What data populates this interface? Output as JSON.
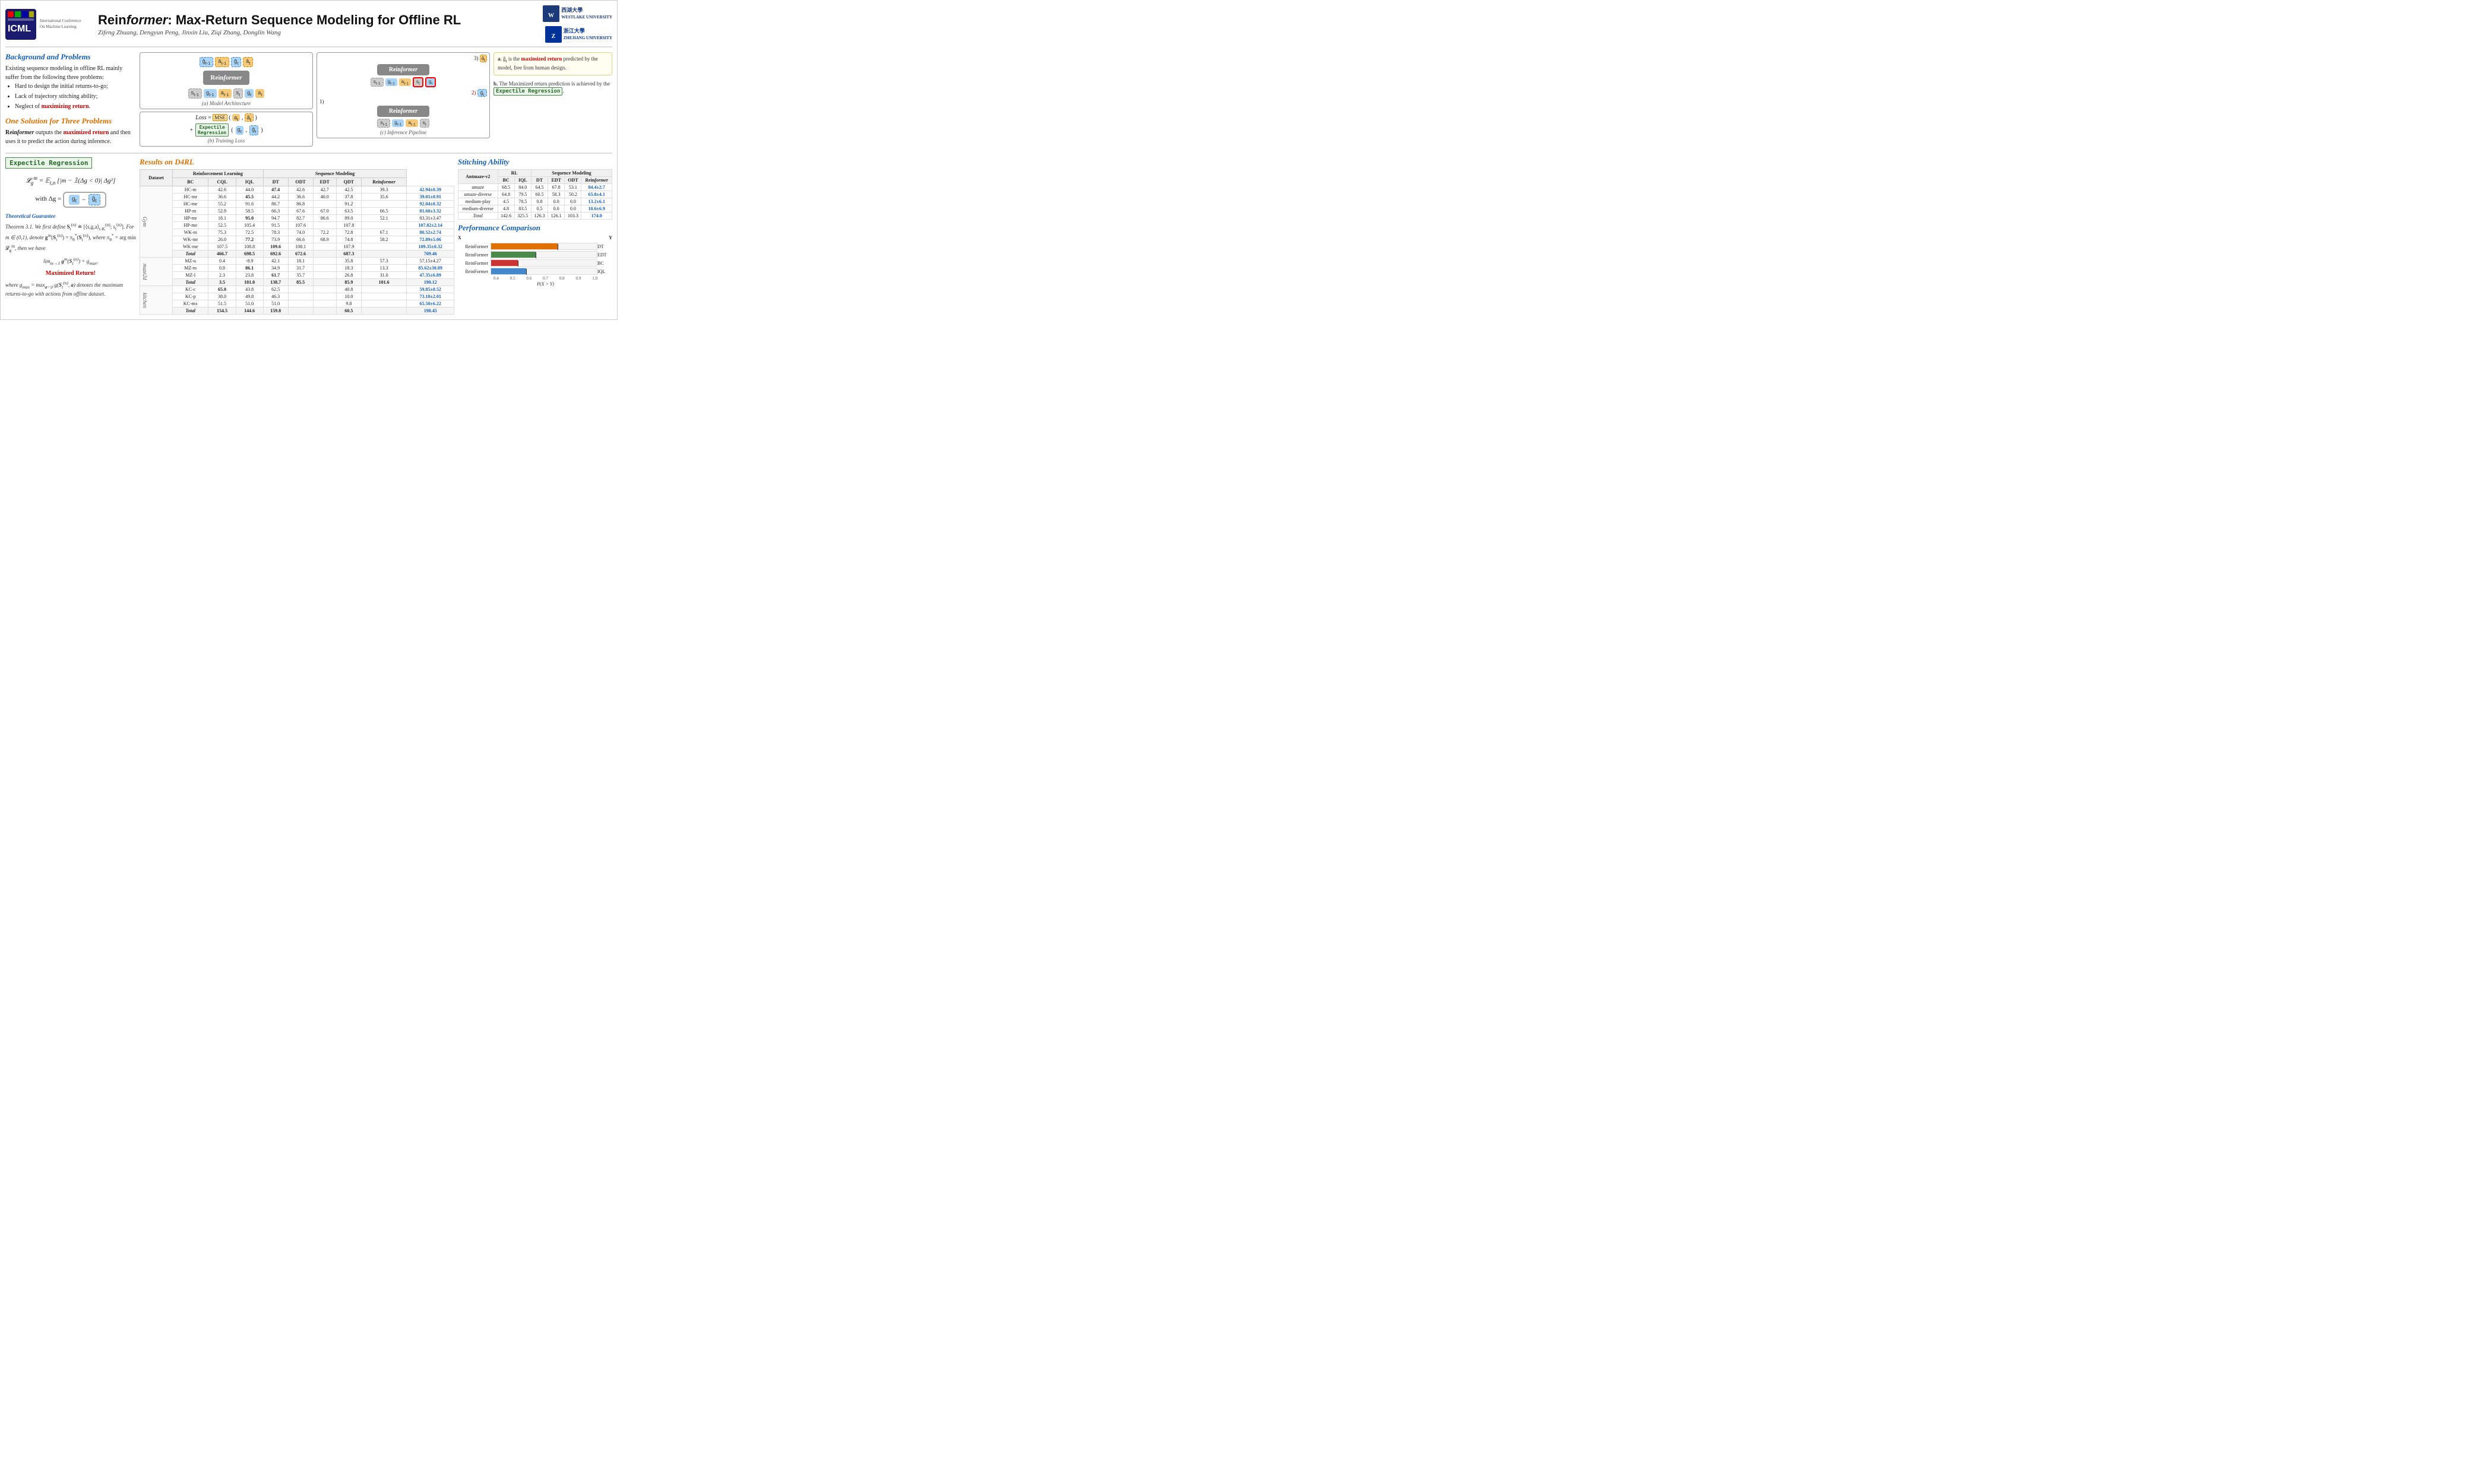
{
  "header": {
    "title_pre": "Rein",
    "title_italic": "former",
    "title_post": ": Max-Return Sequence Modeling for Offline RL",
    "authors": "Zifeng Zhuang, Dengyun Peng, Jinxin Liu, Ziqi Zhang, Donglin Wang",
    "icml_label": "ICML",
    "icml_subtext": "International Conference On Machine Learning",
    "univ1": "西湖大學\nWESTLAKE UNIVERSITY",
    "univ2": "浙江大學\nZHEJIANG UNIVERSITY"
  },
  "background": {
    "title": "Background and Problems",
    "body": "Existing sequence modeling in offline RL mainly suffer from the following three problems:",
    "bullets": [
      "Hard to design the initial returns-to-go;",
      "Lack of trajectory stitching ability;",
      "Neglect of maximizing return."
    ]
  },
  "one_solution": {
    "title": "One Solution for Three Problems",
    "body_pre": "Rein",
    "body_italic": "former",
    "body_post": " outputs the maximized return and then uses it to predict the action during inference."
  },
  "arch_diagram": {
    "title": "(a) Model Architecture",
    "tokens_top": [
      "ĝ_{t-1}",
      "â_{t-1}",
      "ĝ_t",
      "â_t"
    ],
    "reformer_label_pre": "Rein",
    "reformer_label_italic": "former",
    "tokens_bottom": [
      "s_{t-1}",
      "g_{t-1}",
      "a_{t-1}",
      "s_t",
      "g_t",
      "a_t"
    ],
    "loss_title": "(b) Training Loss",
    "loss_eq": "Loss = MSE( a_t , â_t )",
    "loss_plus": "+ Expectile Regression( g_t , ĝ_t )"
  },
  "inference_diagram": {
    "title": "(c) Inference Pipeline",
    "step1": "1)",
    "step2": "2)",
    "step3": "3)"
  },
  "annotations": {
    "a_text": "a. ĝ_t is the maximized return predicted by the model, free from human design.",
    "b_text": "b. The Maximized return prediction is achieved by the Expectile Regression."
  },
  "expectile": {
    "box_label": "Expectile Regression",
    "formula1": "𝓛_g^m = 𝔼_{t,n} [|m − 𝟙(Δg < 0)| Δg²]",
    "formula2": "with Δg = ( g_t − ĝ_t )",
    "theorem_title": "Theoretical Guarantee",
    "theorem_text": "Theorem 3.1. We first define S_t^(n) ≐ [⟨s, g, a⟩_{t-K}^(n); s_t^(n)]. For m ∈ (0,1), denote g^m(S_t^(n)) = π_θ^*(S_t^(n)), where π_θ^* = arg min 𝓛_g^m, then we have",
    "limit_formula": "lim_{m→1} g^m(S_t^(n)) = g_max,",
    "max_return_label": "Maximized Return!",
    "gmax_def": "where g_max = max_{a~𝒟} g(S_t^(n), a) denotes the maximum returns-to-go with actions from offline dataset."
  },
  "results_d4rl": {
    "title": "Results on D4RL",
    "col_groups": [
      {
        "name": "Reinforcement Learning",
        "cols": [
          "BC",
          "CQL",
          "IQL"
        ]
      },
      {
        "name": "Sequence Modeling",
        "cols": [
          "DT",
          "ODT",
          "EDT",
          "QDT",
          "Reformer"
        ]
      }
    ],
    "row_groups": [
      {
        "name": "Gym",
        "rows": [
          {
            "dataset": "HC-m",
            "bc": "42.6",
            "cql": "44.0",
            "iql": "47.4",
            "dt": "42.6",
            "odt": "42.7",
            "edt": "42.5",
            "qdt": "39.3",
            "ref": "42.94±0.39",
            "ref_color": "blue"
          },
          {
            "dataset": "HC-mr",
            "bc": "36.6",
            "cql": "45.5",
            "iql": "44.2",
            "dt": "36.6",
            "odt": "40.0",
            "edt": "37.8",
            "qdt": "35.6",
            "ref": "39.01±0.91",
            "ref_color": "blue"
          },
          {
            "dataset": "HC-me",
            "bc": "55.2",
            "cql": "91.6",
            "iql": "86.7",
            "dt": "86.8",
            "odt": "",
            "edt": "91.2",
            "qdt": "",
            "ref": "92.04±0.32",
            "ref_color": "blue"
          },
          {
            "dataset": "HP-m",
            "bc": "52.9",
            "cql": "58.5",
            "iql": "66.3",
            "dt": "67.6",
            "odt": "67.0",
            "edt": "63.5",
            "qdt": "66.5",
            "ref": "81.60±3.32",
            "ref_color": "blue"
          },
          {
            "dataset": "HP-mr",
            "bc": "18.1",
            "cql": "95.0",
            "iql": "94.7",
            "dt": "82.7",
            "odt": "86.6",
            "edt": "89.0",
            "qdt": "52.1",
            "ref": "83.31±3.47",
            "ref_color": "normal"
          },
          {
            "dataset": "HP-me",
            "bc": "52.5",
            "cql": "105.4",
            "iql": "91.5",
            "dt": "107.6",
            "odt": "",
            "edt": "107.8",
            "qdt": "",
            "ref": "107.82±2.14",
            "ref_color": "blue"
          },
          {
            "dataset": "WK-m",
            "bc": "75.3",
            "cql": "72.5",
            "iql": "78.3",
            "dt": "74.0",
            "odt": "72.2",
            "edt": "72.8",
            "qdt": "67.1",
            "ref": "80.52±2.74",
            "ref_color": "blue"
          },
          {
            "dataset": "WK-mr",
            "bc": "26.0",
            "cql": "77.2",
            "iql": "73.9",
            "dt": "66.6",
            "odt": "68.9",
            "edt": "74.8",
            "qdt": "58.2",
            "ref": "72.89±5.06",
            "ref_color": "blue"
          },
          {
            "dataset": "WK-me",
            "bc": "107.5",
            "cql": "108.8",
            "iql": "109.6",
            "dt": "108.1",
            "odt": "",
            "edt": "107.9",
            "qdt": "",
            "ref": "109.35±0.32",
            "ref_color": "blue"
          }
        ],
        "total": {
          "bc": "466.7",
          "cql": "698.5",
          "iql": "692.6",
          "dt": "672.6",
          "odt": "",
          "edt": "687.3",
          "qdt": "",
          "ref": "709.46",
          "ref_color": "blue"
        }
      },
      {
        "name": "maze2d",
        "rows": [
          {
            "dataset": "MZ-u",
            "bc": "0.4",
            "cql": "-8.9",
            "iql": "42.1",
            "dt": "18.1",
            "odt": "",
            "edt": "35.8",
            "qdt": "57.3",
            "ref": "57.15±4.27",
            "ref_color": "normal"
          },
          {
            "dataset": "MZ-m",
            "bc": "0.8",
            "cql": "86.1",
            "iql": "34.9",
            "dt": "31.7",
            "odt": "",
            "edt": "18.3",
            "qdt": "13.3",
            "ref": "85.62±30.89",
            "ref_color": "blue"
          },
          {
            "dataset": "MZ-l",
            "bc": "2.3",
            "cql": "23.8",
            "iql": "61.7",
            "dt": "35.7",
            "odt": "",
            "edt": "26.8",
            "qdt": "31.0",
            "ref": "47.35±6.89",
            "ref_color": "blue"
          }
        ],
        "total": {
          "bc": "3.5",
          "cql": "101.0",
          "iql": "138.7",
          "dt": "85.5",
          "odt": "",
          "edt": "85.9",
          "qdt": "101.6",
          "ref": "190.12",
          "ref_color": "blue"
        }
      },
      {
        "name": "kitchen",
        "rows": [
          {
            "dataset": "KC-c",
            "bc": "65.0",
            "cql": "43.8",
            "iql": "62.5",
            "dt": "",
            "odt": "",
            "edt": "40.8",
            "qdt": "",
            "ref": "59.85±0.52",
            "ref_color": "blue"
          },
          {
            "dataset": "KC-p",
            "bc": "38.0",
            "cql": "49.8",
            "iql": "46.3",
            "dt": "",
            "odt": "",
            "edt": "10.0",
            "qdt": "",
            "ref": "73.10±2.01",
            "ref_color": "blue"
          },
          {
            "dataset": "KC-mx",
            "bc": "51.5",
            "cql": "51.0",
            "iql": "51.0",
            "dt": "",
            "odt": "",
            "edt": "9.8",
            "qdt": "",
            "ref": "65.50±6.22",
            "ref_color": "blue"
          }
        ],
        "total": {
          "bc": "154.5",
          "cql": "144.6",
          "iql": "159.8",
          "dt": "",
          "odt": "",
          "edt": "60.5",
          "qdt": "",
          "ref": "198.45",
          "ref_color": "blue"
        }
      }
    ]
  },
  "stitching": {
    "title": "Stitching Ability",
    "dataset": "Antmaze-v2",
    "col_groups": [
      {
        "name": "RL",
        "cols": [
          "BC",
          "IQL"
        ]
      },
      {
        "name": "Sequence Modeling",
        "cols": [
          "DT",
          "EDT",
          "ODT",
          "Reformer"
        ]
      }
    ],
    "rows": [
      {
        "name": "umaze",
        "bc": "68.5",
        "iql": "84.0",
        "dt": "64.5",
        "edt": "67.8",
        "odt": "53.1",
        "ref": "84.4±2.7",
        "ref_color": "blue"
      },
      {
        "name": "umaze-diverse",
        "bc": "64.8",
        "iql": "79.5",
        "dt": "60.5",
        "edt": "58.3",
        "odt": "50.2",
        "ref": "65.8±4.1",
        "ref_color": "blue"
      },
      {
        "name": "medium-play",
        "bc": "4.5",
        "iql": "78.5",
        "dt": "0.8",
        "edt": "0.0",
        "odt": "0.0",
        "ref": "13.2±6.1",
        "ref_color": "blue"
      },
      {
        "name": "medium-diverse",
        "bc": "4.8",
        "iql": "83.5",
        "dt": "0.5",
        "edt": "0.0",
        "odt": "0.0",
        "ref": "10.6±6.9",
        "ref_color": "blue"
      }
    ],
    "total": {
      "bc": "142.6",
      "iql": "325.5",
      "dt": "126.3",
      "edt": "126.1",
      "odt": "103.3",
      "ref": "174.0",
      "ref_color": "blue"
    }
  },
  "performance": {
    "title": "Performance Comparison",
    "x_label": "P(X > Y)",
    "x_axis_label": "X",
    "y_axis_label": "Y",
    "bars": [
      {
        "method": "ReinFormer",
        "comparison": "DT",
        "value": 0.78,
        "color": "#e07000"
      },
      {
        "method": "ReinFormer",
        "comparison": "EDT",
        "value": 0.65,
        "color": "#4a8a4a"
      },
      {
        "method": "ReinFormer",
        "comparison": "BC",
        "value": 0.55,
        "color": "#cc3333"
      },
      {
        "method": "ReinFormer",
        "comparison": "IQL",
        "value": 0.6,
        "color": "#4488cc"
      }
    ],
    "axis_ticks": [
      "0.4",
      "0.5",
      "0.6",
      "0.7",
      "0.8",
      "0.9",
      "1.0"
    ]
  }
}
